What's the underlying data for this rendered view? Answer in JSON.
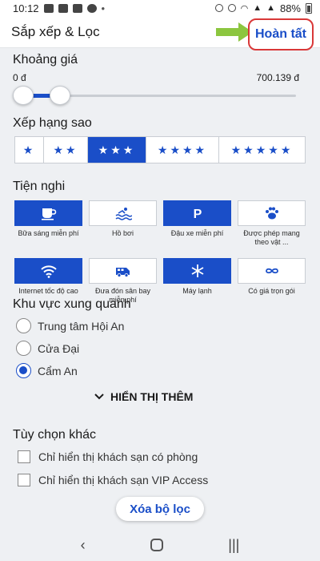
{
  "status_bar": {
    "time": "10:12",
    "battery": "88%"
  },
  "header": {
    "title": "Sắp xếp & Lọc",
    "done_label": "Hoàn tất"
  },
  "price": {
    "section_title": "Khoảng giá",
    "min_label": "0 đ",
    "max_label": "700.139 đ"
  },
  "stars": {
    "section_title": "Xếp hạng sao",
    "options": [
      "★",
      "★★",
      "★★★",
      "★★★★",
      "★★★★★"
    ],
    "selected_index": 2
  },
  "amenities": {
    "section_title": "Tiện nghi",
    "items": [
      {
        "label": "Bữa sáng miễn phí",
        "icon": "breakfast-icon",
        "selected": true
      },
      {
        "label": "Hồ bơi",
        "icon": "pool-icon",
        "selected": false
      },
      {
        "label": "Đậu xe miễn phí",
        "icon": "parking-icon",
        "selected": true
      },
      {
        "label": "Được phép mang theo vật ...",
        "icon": "pet-paw-icon",
        "selected": false
      },
      {
        "label": "Internet tốc độ cao",
        "icon": "wifi-icon",
        "selected": true
      },
      {
        "label": "Đưa đón sân bay miễn phí",
        "icon": "shuttle-icon",
        "selected": false
      },
      {
        "label": "Máy lạnh",
        "icon": "snowflake-icon",
        "selected": true
      },
      {
        "label": "Có giá trọn gói",
        "icon": "infinity-icon",
        "selected": false
      }
    ]
  },
  "areas": {
    "section_title": "Khu vực xung quanh",
    "options": [
      "Trung tâm Hội An",
      "Cửa Đại",
      "Cẩm An"
    ],
    "selected_index": 2,
    "show_more_label": "HIỂN THỊ THÊM"
  },
  "other": {
    "section_title": "Tùy chọn khác",
    "options": [
      "Chỉ hiển thị khách sạn có phòng",
      "Chỉ hiển thị khách sạn VIP Access"
    ]
  },
  "clear_label": "Xóa bộ lọc",
  "colors": {
    "accent": "#1a4ec8",
    "arrow": "#8cc63f",
    "highlight_border": "#d93838"
  }
}
